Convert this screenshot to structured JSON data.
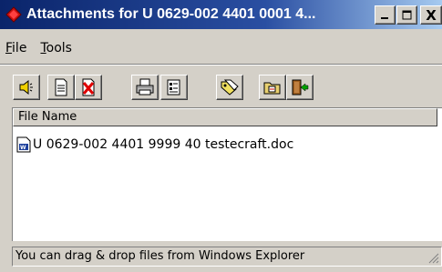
{
  "window": {
    "title": "Attachments for U 0629-002 4401 0001 4...",
    "icon": "red-diamond-icon"
  },
  "caption_buttons": {
    "minimize_icon": "minimize-icon",
    "maximize_icon": "maximize-icon",
    "close_icon": "close-icon",
    "close_label": "X"
  },
  "menu": {
    "file": {
      "first": "F",
      "rest": "ile"
    },
    "tools": {
      "first": "T",
      "rest": "ools"
    }
  },
  "toolbar": {
    "buttons": [
      {
        "icon": "speaker-icon"
      },
      {
        "icon": "new-document-icon"
      },
      {
        "icon": "delete-document-icon"
      },
      {
        "icon": "print-icon"
      },
      {
        "icon": "properties-icon"
      },
      {
        "icon": "scan-icon"
      },
      {
        "icon": "folder-icon"
      },
      {
        "icon": "exit-icon"
      }
    ]
  },
  "list": {
    "column_header": "File Name",
    "items": [
      {
        "name": "U 0629-002 4401 9999 40 testecraft.doc",
        "icon": "word-document-icon"
      }
    ]
  },
  "status": {
    "text": "You can drag & drop files from Windows Explorer"
  },
  "colors": {
    "titlebar_start": "#0a246a",
    "titlebar_end": "#a6caf0",
    "face": "#d4d0c8"
  }
}
